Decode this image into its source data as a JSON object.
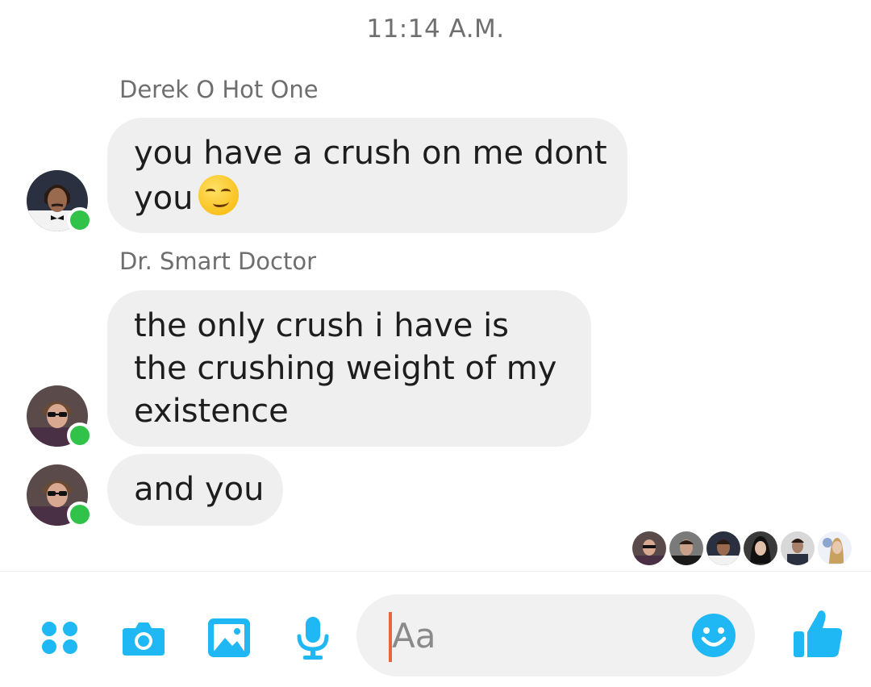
{
  "thread": {
    "timestamp": "11:14 A.M."
  },
  "messages": [
    {
      "sender": "Derek O Hot One",
      "lines": [
        "you have a crush on me dont",
        "you"
      ],
      "emoji": "smirking-face-emoji"
    },
    {
      "sender": "Dr. Smart Doctor",
      "lines": [
        "the only crush i have is",
        "the crushing weight of my",
        "existence"
      ]
    },
    {
      "lines": [
        "and you"
      ]
    }
  ],
  "read_receipts": {
    "count": 6
  },
  "composer": {
    "placeholder": "Aa",
    "value": "",
    "icons": [
      "more-icon",
      "camera-icon",
      "image-icon",
      "microphone-icon",
      "emoji-icon",
      "thumbs-up-icon"
    ]
  },
  "colors": {
    "accent": "#1fb8f5",
    "bubble": "#efefef",
    "online": "#31c24a",
    "caret": "#e8663a"
  }
}
